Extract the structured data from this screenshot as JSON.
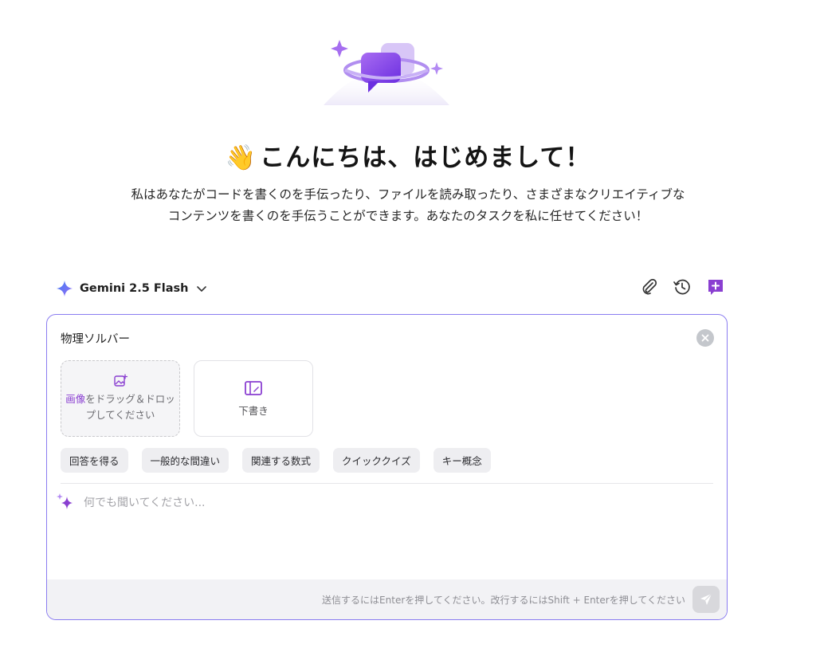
{
  "hero": {
    "wave_emoji": "👋",
    "title": "こんにちは、はじめまして！",
    "description_line1": "私はあなたがコードを書くのを手伝ったり、ファイルを読み取ったり、さまざまなクリエイティブな",
    "description_line2": "コンテンツを書くのを手伝うことができます。あなたのタスクを私に任せてください！"
  },
  "model_bar": {
    "model_name": "Gemini 2.5 Flash",
    "icons": [
      "gemini-sparkle-icon",
      "chevron-down-icon",
      "paperclip-icon",
      "history-icon",
      "new-chat-icon"
    ]
  },
  "panel": {
    "title": "物理ソルバー",
    "upload": {
      "accent": "画像",
      "rest": "をドラッグ＆ドロップしてください"
    },
    "draft_label": "下書き",
    "chips": [
      "回答を得る",
      "一般的な間違い",
      "関連する数式",
      "クイッククイズ",
      "キー概念"
    ],
    "input_placeholder": "何でも聞いてください...",
    "footer_hint": "送信するにはEnterを押してください。改行するにはShift + Enterを押してください"
  },
  "colors": {
    "accent": "#8a3fd1",
    "panel_border": "#8a7cf0",
    "gemini_blue": "#4f7df3"
  }
}
